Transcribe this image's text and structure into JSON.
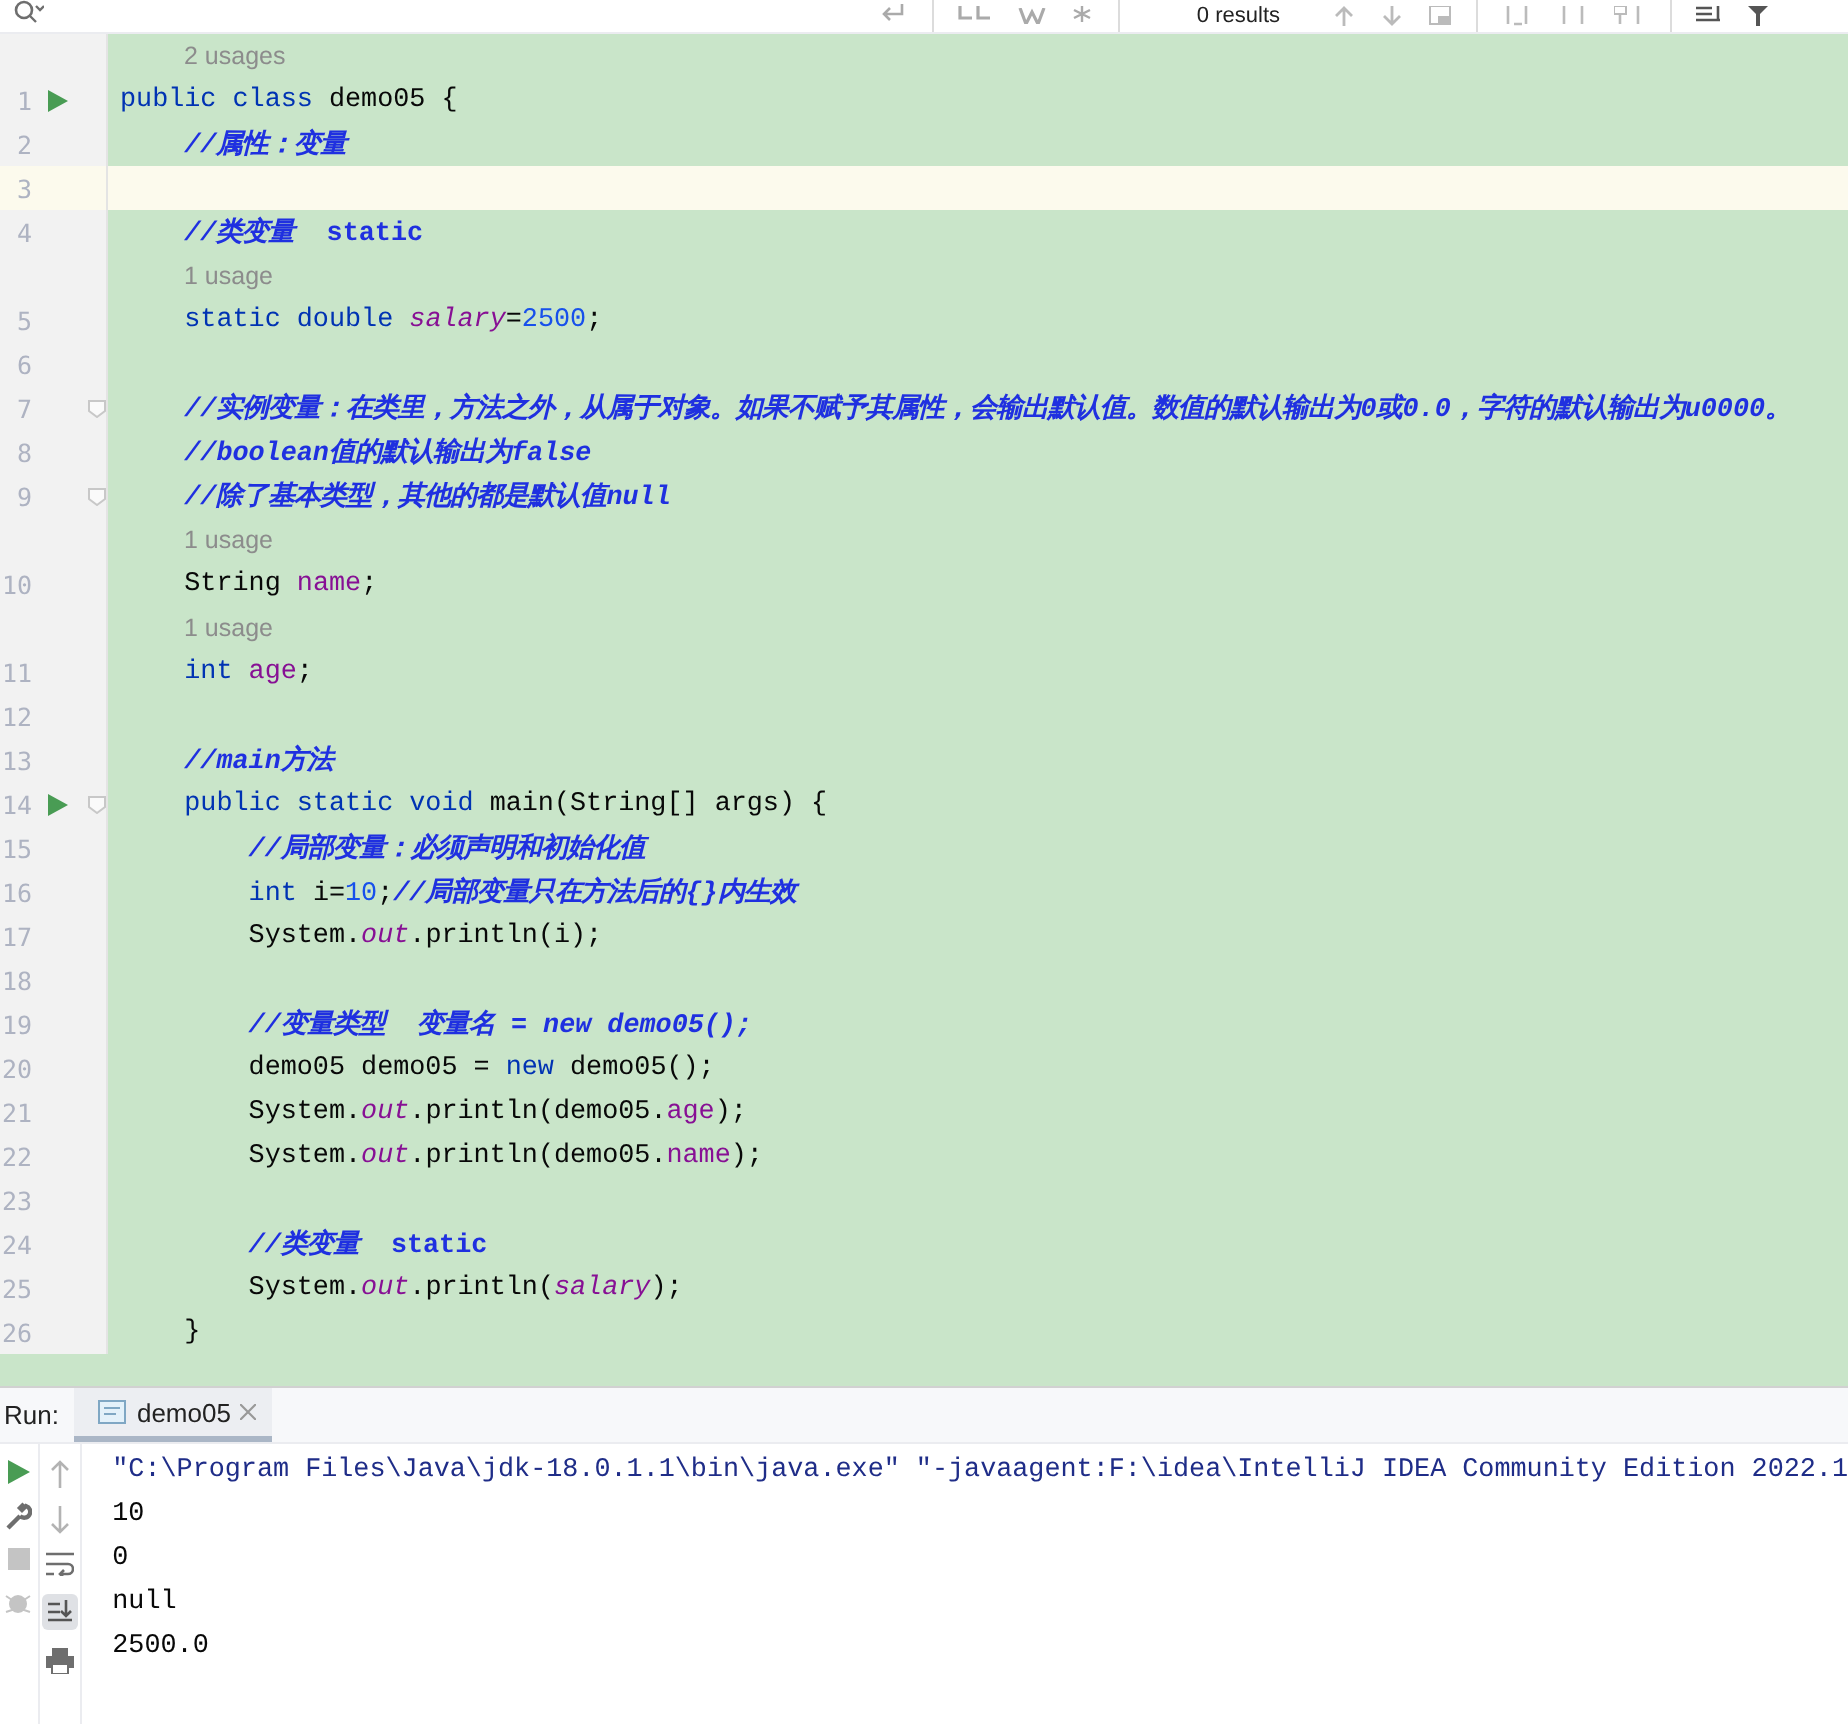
{
  "find_bar": {
    "results": "0 results"
  },
  "editor": {
    "rows": [
      {
        "kind": "hint",
        "text": "2 usages"
      },
      {
        "kind": "code",
        "number": "1",
        "run": true,
        "fold": false,
        "current": false,
        "tokens": [
          {
            "kind": "kw",
            "text": "public class "
          },
          {
            "kind": "plain",
            "text": "demo05 {"
          }
        ]
      },
      {
        "kind": "code",
        "number": "2",
        "run": false,
        "fold": false,
        "current": false,
        "tokens": [
          {
            "kind": "comment",
            "text": "    //属性：变量"
          }
        ]
      },
      {
        "kind": "code",
        "number": "3",
        "run": false,
        "fold": false,
        "current": true,
        "tokens": []
      },
      {
        "kind": "code",
        "number": "4",
        "run": false,
        "fold": false,
        "current": false,
        "tokens": [
          {
            "kind": "comment",
            "text": "    //类变量  "
          },
          {
            "kind": "comment-upright",
            "text": "static"
          }
        ]
      },
      {
        "kind": "hint",
        "text": "1 usage"
      },
      {
        "kind": "code",
        "number": "5",
        "run": false,
        "fold": false,
        "current": false,
        "tokens": [
          {
            "kind": "kw",
            "text": "    static double "
          },
          {
            "kind": "static-field",
            "text": "salary"
          },
          {
            "kind": "plain",
            "text": "="
          },
          {
            "kind": "num",
            "text": "2500"
          },
          {
            "kind": "plain",
            "text": ";"
          }
        ]
      },
      {
        "kind": "code",
        "number": "6",
        "run": false,
        "fold": false,
        "current": false,
        "tokens": []
      },
      {
        "kind": "code",
        "number": "7",
        "run": false,
        "fold": true,
        "current": false,
        "tokens": [
          {
            "kind": "comment",
            "text": "    //实例变量：在类里，方法之外，从属于对象。如果不赋予其属性，会输出默认值。数值的默认输出为0或0.0，字符的默认输出为u0000。"
          }
        ]
      },
      {
        "kind": "code",
        "number": "8",
        "run": false,
        "fold": false,
        "current": false,
        "tokens": [
          {
            "kind": "comment",
            "text": "    //boolean值的默认输出为false"
          }
        ]
      },
      {
        "kind": "code",
        "number": "9",
        "run": false,
        "fold": true,
        "current": false,
        "tokens": [
          {
            "kind": "comment",
            "text": "    //除了基本类型，其他的都是默认值null"
          }
        ]
      },
      {
        "kind": "hint",
        "text": "1 usage"
      },
      {
        "kind": "code",
        "number": "10",
        "run": false,
        "fold": false,
        "current": false,
        "tokens": [
          {
            "kind": "plain",
            "text": "    String "
          },
          {
            "kind": "field",
            "text": "name"
          },
          {
            "kind": "plain",
            "text": ";"
          }
        ]
      },
      {
        "kind": "hint",
        "text": "1 usage"
      },
      {
        "kind": "code",
        "number": "11",
        "run": false,
        "fold": false,
        "current": false,
        "tokens": [
          {
            "kind": "kw",
            "text": "    int "
          },
          {
            "kind": "field",
            "text": "age"
          },
          {
            "kind": "plain",
            "text": ";"
          }
        ]
      },
      {
        "kind": "code",
        "number": "12",
        "run": false,
        "fold": false,
        "current": false,
        "tokens": []
      },
      {
        "kind": "code",
        "number": "13",
        "run": false,
        "fold": false,
        "current": false,
        "tokens": [
          {
            "kind": "comment",
            "text": "    //main方法"
          }
        ]
      },
      {
        "kind": "code",
        "number": "14",
        "run": true,
        "fold": true,
        "current": false,
        "tokens": [
          {
            "kind": "kw",
            "text": "    public static void "
          },
          {
            "kind": "plain",
            "text": "main(String[] args) {"
          }
        ]
      },
      {
        "kind": "code",
        "number": "15",
        "run": false,
        "fold": false,
        "current": false,
        "tokens": [
          {
            "kind": "comment",
            "text": "        //局部变量：必须声明和初始化值"
          }
        ]
      },
      {
        "kind": "code",
        "number": "16",
        "run": false,
        "fold": false,
        "current": false,
        "tokens": [
          {
            "kind": "kw",
            "text": "        int "
          },
          {
            "kind": "plain",
            "text": "i="
          },
          {
            "kind": "num",
            "text": "10"
          },
          {
            "kind": "plain",
            "text": ";"
          },
          {
            "kind": "comment",
            "text": "//局部变量只在方法后的{}内生效"
          }
        ]
      },
      {
        "kind": "code",
        "number": "17",
        "run": false,
        "fold": false,
        "current": false,
        "tokens": [
          {
            "kind": "plain",
            "text": "        System."
          },
          {
            "kind": "static-field",
            "text": "out"
          },
          {
            "kind": "plain",
            "text": ".println(i);"
          }
        ]
      },
      {
        "kind": "code",
        "number": "18",
        "run": false,
        "fold": false,
        "current": false,
        "tokens": []
      },
      {
        "kind": "code",
        "number": "19",
        "run": false,
        "fold": false,
        "current": false,
        "tokens": [
          {
            "kind": "comment",
            "text": "        //变量类型  变量名 = new demo05();"
          }
        ]
      },
      {
        "kind": "code",
        "number": "20",
        "run": false,
        "fold": false,
        "current": false,
        "tokens": [
          {
            "kind": "plain",
            "text": "        demo05 demo05 = "
          },
          {
            "kind": "kw",
            "text": "new "
          },
          {
            "kind": "plain",
            "text": "demo05();"
          }
        ]
      },
      {
        "kind": "code",
        "number": "21",
        "run": false,
        "fold": false,
        "current": false,
        "tokens": [
          {
            "kind": "plain",
            "text": "        System."
          },
          {
            "kind": "static-field",
            "text": "out"
          },
          {
            "kind": "plain",
            "text": ".println(demo05."
          },
          {
            "kind": "field",
            "text": "age"
          },
          {
            "kind": "plain",
            "text": ");"
          }
        ]
      },
      {
        "kind": "code",
        "number": "22",
        "run": false,
        "fold": false,
        "current": false,
        "tokens": [
          {
            "kind": "plain",
            "text": "        System."
          },
          {
            "kind": "static-field",
            "text": "out"
          },
          {
            "kind": "plain",
            "text": ".println(demo05."
          },
          {
            "kind": "field",
            "text": "name"
          },
          {
            "kind": "plain",
            "text": ");"
          }
        ]
      },
      {
        "kind": "code",
        "number": "23",
        "run": false,
        "fold": false,
        "current": false,
        "tokens": []
      },
      {
        "kind": "code",
        "number": "24",
        "run": false,
        "fold": false,
        "current": false,
        "tokens": [
          {
            "kind": "comment",
            "text": "        //类变量  "
          },
          {
            "kind": "comment-upright",
            "text": "static"
          }
        ]
      },
      {
        "kind": "code",
        "number": "25",
        "run": false,
        "fold": false,
        "current": false,
        "tokens": [
          {
            "kind": "plain",
            "text": "        System."
          },
          {
            "kind": "static-field",
            "text": "out"
          },
          {
            "kind": "plain",
            "text": ".println("
          },
          {
            "kind": "static-field",
            "text": "salary"
          },
          {
            "kind": "plain",
            "text": ");"
          }
        ]
      },
      {
        "kind": "code",
        "number": "26",
        "run": false,
        "fold": false,
        "current": false,
        "tokens": [
          {
            "kind": "plain",
            "text": "    }"
          }
        ]
      }
    ]
  },
  "run_panel": {
    "label": "Run:",
    "tab": {
      "title": "demo05",
      "selected": true
    },
    "output": [
      {
        "kind": "command",
        "text": "\"C:\\Program Files\\Java\\jdk-18.0.1.1\\bin\\java.exe\" \"-javaagent:F:\\idea\\IntelliJ IDEA Community Edition 2022.1"
      },
      {
        "kind": "stdout",
        "text": "10"
      },
      {
        "kind": "stdout",
        "text": "0"
      },
      {
        "kind": "stdout",
        "text": "null"
      },
      {
        "kind": "stdout",
        "text": "2500.0"
      }
    ]
  }
}
